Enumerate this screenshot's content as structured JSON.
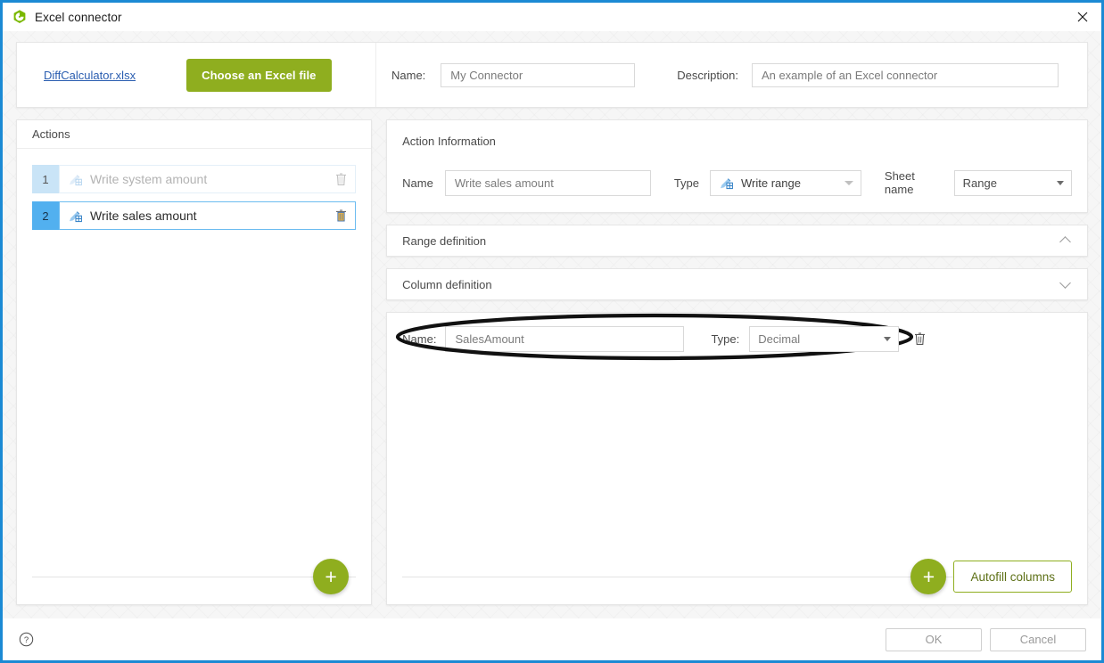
{
  "window": {
    "title": "Excel connector",
    "icon": "excel-connector-icon",
    "close_label": "✕"
  },
  "header": {
    "file_link": "DiffCalculator.xlsx",
    "choose_button": "Choose an Excel file",
    "name_label": "Name:",
    "name_value": "My Connector",
    "description_label": "Description:",
    "description_value": "An example of an Excel connector"
  },
  "actions_panel": {
    "heading": "Actions",
    "items": [
      {
        "number": "1",
        "label": "Write system amount",
        "state": "inactive"
      },
      {
        "number": "2",
        "label": "Write sales amount",
        "state": "selected"
      }
    ],
    "add_label": "+"
  },
  "action_information": {
    "heading": "Action Information",
    "name_label": "Name",
    "name_value": "Write sales amount",
    "type_label": "Type",
    "type_value": "Write range",
    "sheet_label": "Sheet name",
    "sheet_value": "Range"
  },
  "range_definition": {
    "title": "Range definition",
    "chevron": "chevron-up-icon"
  },
  "column_definition": {
    "title": "Column definition",
    "chevron": "chevron-down-icon",
    "rows": [
      {
        "name_label": "Name:",
        "name_value": "SalesAmount",
        "type_label": "Type:",
        "type_value": "Decimal"
      }
    ],
    "add_label": "+",
    "autofill_label": "Autofill columns"
  },
  "footer": {
    "help_icon": "help-icon",
    "ok_label": "OK",
    "cancel_label": "Cancel"
  },
  "colors": {
    "accent_blue": "#1b8ad4",
    "brand_green": "#8fae1f",
    "selected_row_blue": "#52b0ef",
    "inactive_row_blue": "#c9e4f7",
    "link_blue": "#2a5db0"
  }
}
